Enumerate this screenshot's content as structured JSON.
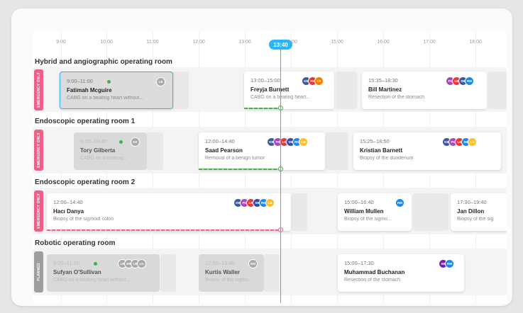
{
  "timeline": {
    "hours": [
      "9:00",
      "10:00",
      "11:00",
      "12:00",
      "13:00",
      "14:00",
      "15:00",
      "16:00",
      "17:00",
      "18:00"
    ],
    "current_time": "13:40"
  },
  "colors": {
    "accent": "#29b6f6",
    "in_progress_green": "#4caf50",
    "overdue_red": "#f06292",
    "emergency_tag": "#ec5f86",
    "planned_tag": "#9e9e9e"
  },
  "rooms": [
    {
      "title": "Hybrid and angiographic operating room",
      "tag": "EMERGENCY ONLY",
      "cards": [
        {
          "time": "9:00–11:00",
          "name": "Fatimah Mcguire",
          "desc": "CABG on a beating heart without...",
          "avatars": [
            "LB"
          ]
        },
        {
          "time": "13:00–15:00",
          "name": "Freyja Burnett",
          "desc": "CABG on a beating heart...",
          "avatars": [
            "KB",
            "FK",
            "LB"
          ]
        },
        {
          "time": "15:35–18:30",
          "name": "Bill Martinez",
          "desc": "Resection of the stomach",
          "avatars": [
            "FK",
            "LB",
            "SB",
            "RM"
          ]
        }
      ]
    },
    {
      "title": "Endoscopic operating room 1",
      "tag": "EMERGENCY ONLY",
      "cards": [
        {
          "time": "9:10–10:40",
          "name": "Tory Gilberta",
          "desc": "CABG on a beating...",
          "avatars": [
            "DK"
          ]
        },
        {
          "time": "12:00–14:40",
          "name": "Saad Pearson",
          "desc": "Removal of a benign tumor",
          "avatars": [
            "KB",
            "FK",
            "LB",
            "SB",
            "RM",
            "LB"
          ]
        },
        {
          "time": "15:25–18:50",
          "name": "Kristian Barnett",
          "desc": "Biopsy of the duodenum",
          "avatars": [
            "KB",
            "FK",
            "LB",
            "SB",
            "LN"
          ]
        }
      ]
    },
    {
      "title": "Endoscopic operating room 2",
      "tag": "EMERGENCY ONLY",
      "cards": [
        {
          "time": "12:00–14:40",
          "name": "Hacı Danya",
          "desc": "Biopsy of the sigmoid colon",
          "avatars": [
            "KB",
            "FK",
            "LB",
            "SB",
            "RM",
            "LB"
          ]
        },
        {
          "time": "15:00–16:40",
          "name": "William Mullen",
          "desc": "Biopsy of the sigmo...",
          "avatars": [
            "RM"
          ]
        },
        {
          "time": "17:30–19:40",
          "name": "Jan Dillon",
          "desc": "Biopsy of the sig",
          "avatars": []
        }
      ]
    },
    {
      "title": "Robotic operating room",
      "tag": "PLANNED",
      "cards": [
        {
          "time": "9:20–11:10",
          "name": "Sufyan O'Sullivan",
          "desc": "CABG on a beating heart without...",
          "avatars": [
            "LB",
            "DR",
            "LB",
            "LN"
          ]
        },
        {
          "time": "12:50–13:40",
          "name": "Kurtis Waller",
          "desc": "Biopsy of the sigmo...",
          "avatars": [
            "RM"
          ]
        },
        {
          "time": "15:00–17:30",
          "name": "Muhammad Buchanan",
          "desc": "Resection of the stomach",
          "avatars": [
            "SB",
            "RM"
          ]
        }
      ]
    }
  ]
}
